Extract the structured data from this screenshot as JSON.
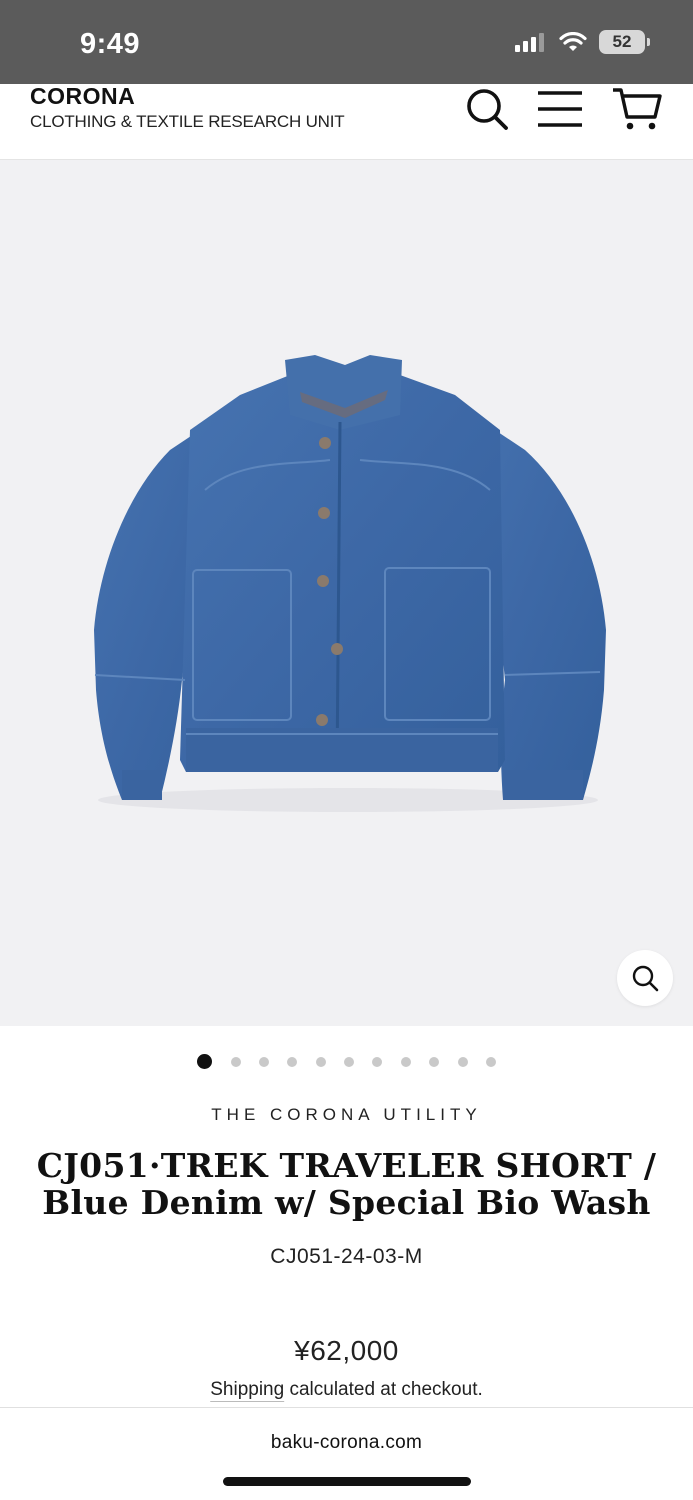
{
  "status_bar": {
    "time": "9:49",
    "battery": "52",
    "icons": [
      "cellular-signal-icon",
      "wifi-icon",
      "battery-icon"
    ]
  },
  "header": {
    "brand_name": "CORONA",
    "tagline": "CLOTHING & TEXTILE RESEARCH UNIT",
    "icons": [
      "search-icon",
      "menu-icon",
      "cart-icon"
    ]
  },
  "gallery": {
    "image": "denim-jacket-image",
    "zoom_icon": "zoom-icon",
    "slide_count": 11,
    "active_slide": 1
  },
  "product": {
    "vendor": "THE CORONA UTILITY",
    "title": "CJ051·TREK TRAVELER SHORT / Blue Denim w/ Special Bio Wash",
    "sku": "CJ051-24-03-M",
    "price": "¥62,000",
    "shipping_link": "Shipping",
    "shipping_rest": " calculated at checkout."
  },
  "browser": {
    "address": "baku-corona.com"
  },
  "colors": {
    "status_bar": "#5b5b5b",
    "gallery_bg": "#f1f1f3",
    "denim": "#3d68a6",
    "text": "#111111"
  }
}
